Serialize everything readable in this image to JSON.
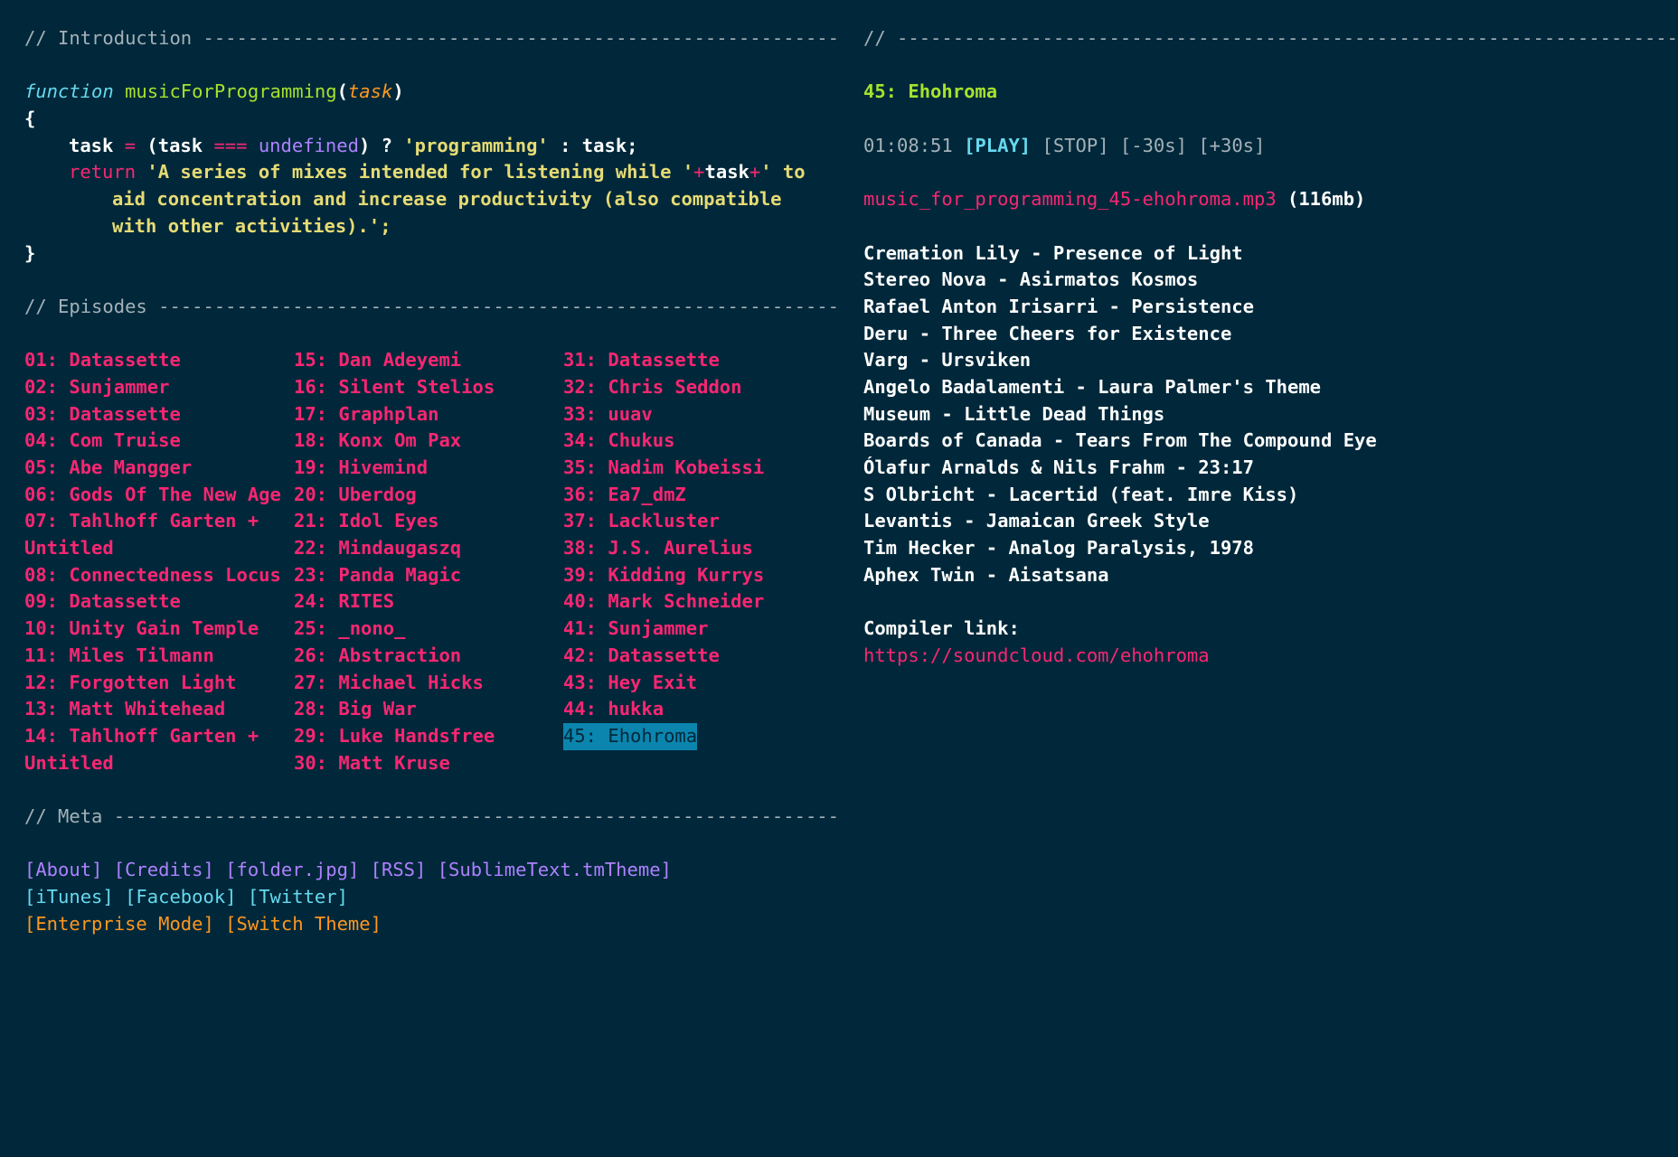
{
  "intro": {
    "heading": "// Introduction -----------------------------------------------------------",
    "code": {
      "function_kw": "function",
      "fn_name": "musicForProgramming",
      "open_paren": "(",
      "param": "task",
      "close_paren": ")",
      "open_brace": "{",
      "l1_a": "task ",
      "l1_eq": "=",
      "l1_b": " (task ",
      "l1_eqeq": "===",
      "l1_c": " ",
      "l1_undef": "undefined",
      "l1_d": ") ? ",
      "l1_str": "'programming'",
      "l1_e": " : task;",
      "l2_return": "return",
      "l2_str1": " 'A series of mixes intended for listening while '",
      "l2_plus1": "+",
      "l2_task": "task",
      "l2_plus2": "+",
      "l2_str2": "' to",
      "l3": "aid concentration and increase productivity (also compatible",
      "l4": "with other activities).';",
      "close_brace": "}"
    }
  },
  "episodes": {
    "heading": "// Episodes ---------------------------------------------------------------",
    "col1": [
      "01: Datassette",
      "02: Sunjammer",
      "03: Datassette",
      "04: Com Truise",
      "05: Abe Mangger",
      "06: Gods Of The New Age",
      "07: Tahlhoff Garten + Untitled",
      "08: Connectedness Locus",
      "09: Datassette",
      "10: Unity Gain Temple",
      "11: Miles Tilmann",
      "12: Forgotten Light",
      "13: Matt Whitehead",
      "14: Tahlhoff Garten + Untitled"
    ],
    "col2": [
      "15: Dan Adeyemi",
      "16: Silent Stelios",
      "17: Graphplan",
      "18: Konx Om Pax",
      "19: Hivemind",
      "20: Uberdog",
      "21: Idol Eyes",
      "22: Mindaugaszq",
      "23: Panda Magic",
      "24: RITES",
      "25: _nono_",
      "26: Abstraction",
      "27: Michael Hicks",
      "28: Big War",
      "29: Luke Handsfree",
      "30: Matt Kruse"
    ],
    "col3": [
      "31: Datassette",
      "32: Chris Seddon",
      "33: uuav",
      "34: Chukus",
      "35: Nadim Kobeissi",
      "36: Ea7_dmZ",
      "37: Lackluster",
      "38: J.S. Aurelius",
      "39: Kidding Kurrys",
      "40: Mark Schneider",
      "41: Sunjammer",
      "42: Datassette",
      "43: Hey Exit",
      "44: hukka",
      "45: Ehohroma"
    ],
    "active": "45: Ehohroma"
  },
  "meta": {
    "heading": "// Meta -------------------------------------------------------------------",
    "row1": [
      "[About]",
      "[Credits]",
      "[folder.jpg]",
      "[RSS]",
      "[SublimeText.tmTheme]"
    ],
    "row2": [
      "[iTunes]",
      "[Facebook]",
      "[Twitter]"
    ],
    "row3": [
      "[Enterprise Mode]",
      "[Switch Theme]"
    ]
  },
  "player": {
    "heading": "// --------------------------------------------------------------------------",
    "title": "45: Ehohroma",
    "time": "01:08:51",
    "play": "[PLAY]",
    "stop": "[STOP]",
    "back30": "[-30s]",
    "fwd30": "[+30s]",
    "file": "music_for_programming_45-ehohroma.mp3",
    "size": "(116mb)",
    "tracks": [
      "Cremation Lily - Presence of Light",
      "Stereo Nova - Asirmatos Kosmos",
      "Rafael Anton Irisarri - Persistence",
      "Deru - Three Cheers for Existence",
      "Varg - Ursviken",
      "Angelo Badalamenti - Laura Palmer's Theme",
      "Museum - Little Dead Things",
      "Boards of Canada - Tears From The Compound Eye",
      "Ólafur Arnalds & Nils Frahm - 23:17",
      "S Olbricht - Lacertid (feat. Imre Kiss)",
      "Levantis - Jamaican Greek Style",
      "Tim Hecker - Analog Paralysis, 1978",
      "Aphex Twin - Aisatsana"
    ],
    "compiler_label": "Compiler link:",
    "compiler_url": "https://soundcloud.com/ehohroma"
  },
  "colors": {
    "background": "#00283a",
    "episode": "#f92672",
    "active_bg": "#0b85ae",
    "green": "#a6e22e",
    "blue": "#66d9ef",
    "purple": "#ae81ff",
    "orange": "#fd971f",
    "yellow": "#e6db74"
  }
}
